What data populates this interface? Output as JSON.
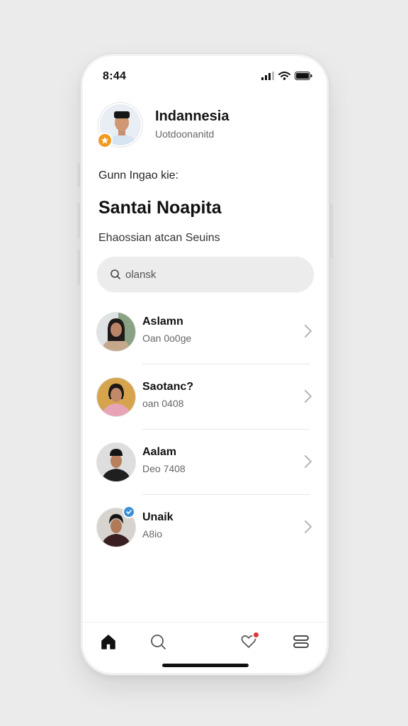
{
  "status_bar": {
    "time": "8:44"
  },
  "profile": {
    "name": "Indannesia",
    "subtitle": "Uotdoonanitd",
    "badge_icon": "star-badge-icon",
    "badge_color": "#f29a1f"
  },
  "greeting": "Gunn Ingao kie:",
  "title": "Santai Noapita",
  "description": "Ehaossian atcan Seuins",
  "search": {
    "placeholder": "olansk",
    "icon": "search-icon"
  },
  "contacts": [
    {
      "name": "Aslamn",
      "meta": "Oan 0o0ge",
      "avatar_bg": "#dfe3e4"
    },
    {
      "name": "Saotanc?",
      "meta": "oan 0408",
      "avatar_bg": "#d6a44c"
    },
    {
      "name": "Aalam",
      "meta": "Deo 7408",
      "avatar_bg": "#dedede"
    },
    {
      "name": "Unaik",
      "meta": "A8io",
      "avatar_bg": "#d7d4d0",
      "verified": true
    }
  ],
  "tabbar": {
    "items": [
      "home-icon",
      "search-icon",
      "heart-icon",
      "menu-icon"
    ],
    "notification_color": "#e0353c"
  },
  "colors": {
    "background": "#ebebec",
    "search_bg": "#ececed",
    "text": "#111111"
  }
}
